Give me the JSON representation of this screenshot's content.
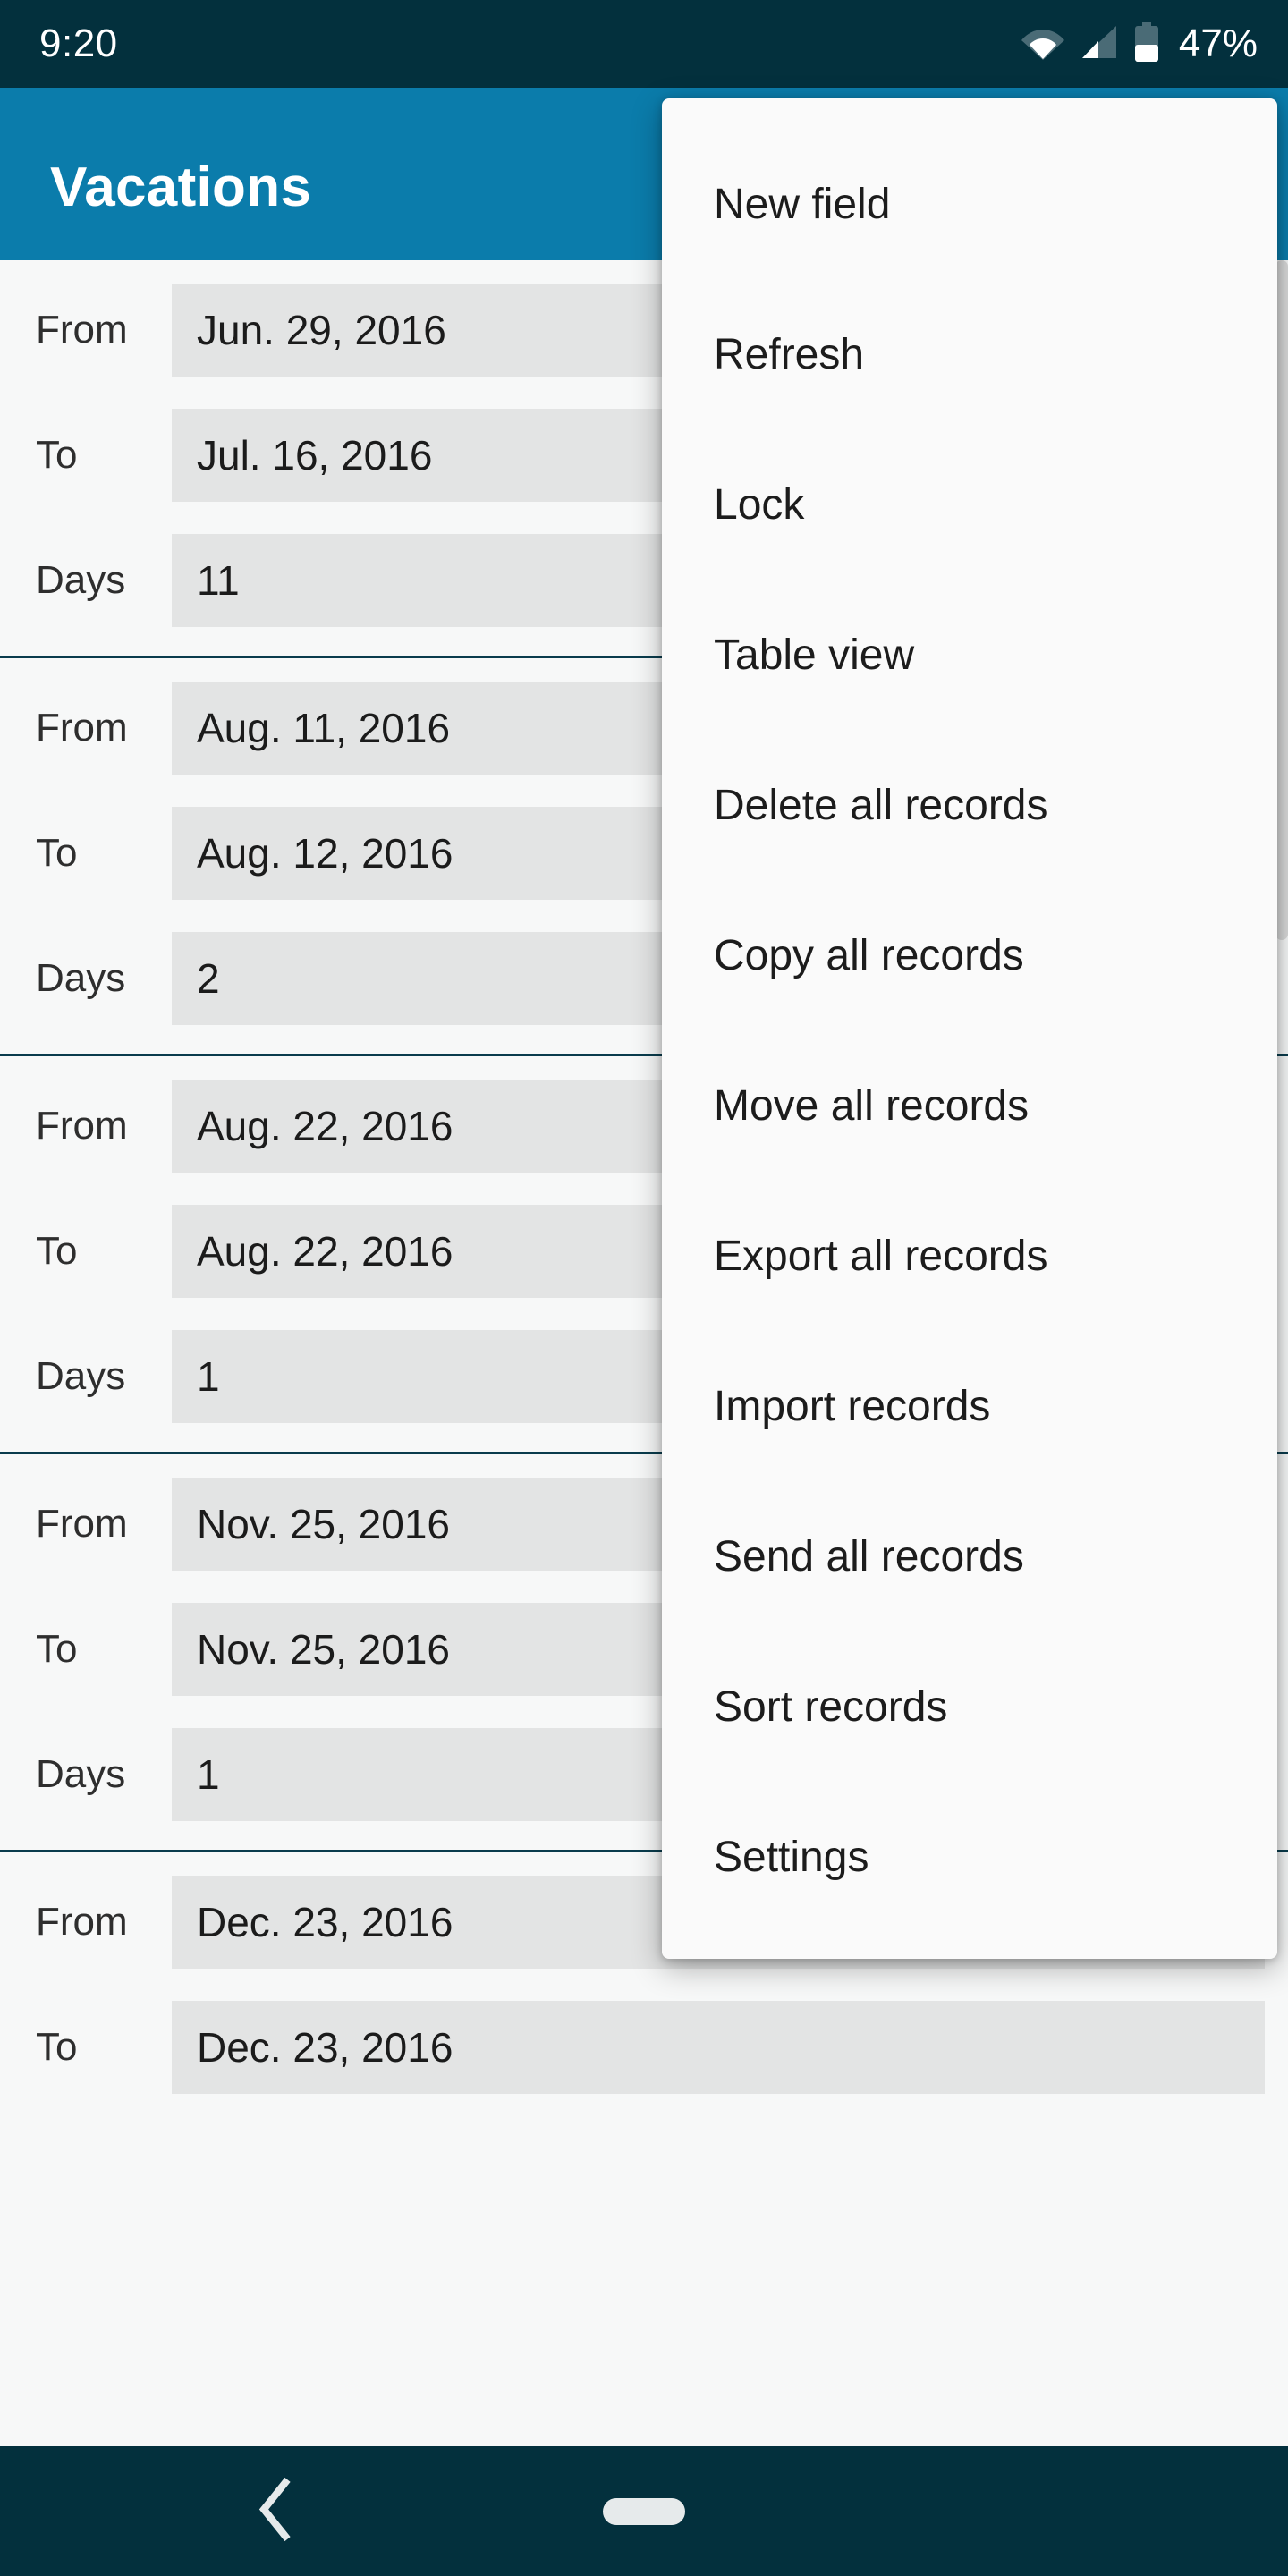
{
  "status_bar": {
    "clock": "9:20",
    "battery_percent": "47%",
    "icons": [
      "wifi-icon",
      "cellular-signal-icon",
      "battery-icon"
    ],
    "background_color": "#03303d"
  },
  "app_bar": {
    "title": "Vacations",
    "background_color": "#0b7cab"
  },
  "records": [
    {
      "fields": [
        {
          "label": "From",
          "value": "Jun. 29, 2016"
        },
        {
          "label": "To",
          "value": "Jul. 16, 2016"
        },
        {
          "label": "Days",
          "value": "11"
        }
      ]
    },
    {
      "fields": [
        {
          "label": "From",
          "value": "Aug. 11, 2016"
        },
        {
          "label": "To",
          "value": "Aug. 12, 2016"
        },
        {
          "label": "Days",
          "value": "2"
        }
      ]
    },
    {
      "fields": [
        {
          "label": "From",
          "value": "Aug. 22, 2016"
        },
        {
          "label": "To",
          "value": "Aug. 22, 2016"
        },
        {
          "label": "Days",
          "value": "1"
        }
      ]
    },
    {
      "fields": [
        {
          "label": "From",
          "value": "Nov. 25, 2016"
        },
        {
          "label": "To",
          "value": "Nov. 25, 2016"
        },
        {
          "label": "Days",
          "value": "1"
        }
      ]
    },
    {
      "fields": [
        {
          "label": "From",
          "value": "Dec. 23, 2016"
        },
        {
          "label": "To",
          "value": "Dec. 23, 2016"
        }
      ]
    }
  ],
  "popup_menu": {
    "items": [
      {
        "label": "New field"
      },
      {
        "label": "Refresh"
      },
      {
        "label": "Lock"
      },
      {
        "label": "Table view"
      },
      {
        "label": "Delete all records"
      },
      {
        "label": "Copy all records"
      },
      {
        "label": "Move all records"
      },
      {
        "label": "Export all records"
      },
      {
        "label": "Import records"
      },
      {
        "label": "Send all records"
      },
      {
        "label": "Sort records"
      },
      {
        "label": "Settings"
      }
    ]
  },
  "nav_bar": {
    "back_icon": "back-chevron-icon",
    "home_icon": "home-pill-icon"
  },
  "colors": {
    "status_bar": "#03303d",
    "accent_blue": "#0b7cab",
    "page_background": "#f7f8f8",
    "field_value_background": "#e3e4e4",
    "record_divider": "#0a3c4d",
    "menu_background": "#fafafa"
  }
}
